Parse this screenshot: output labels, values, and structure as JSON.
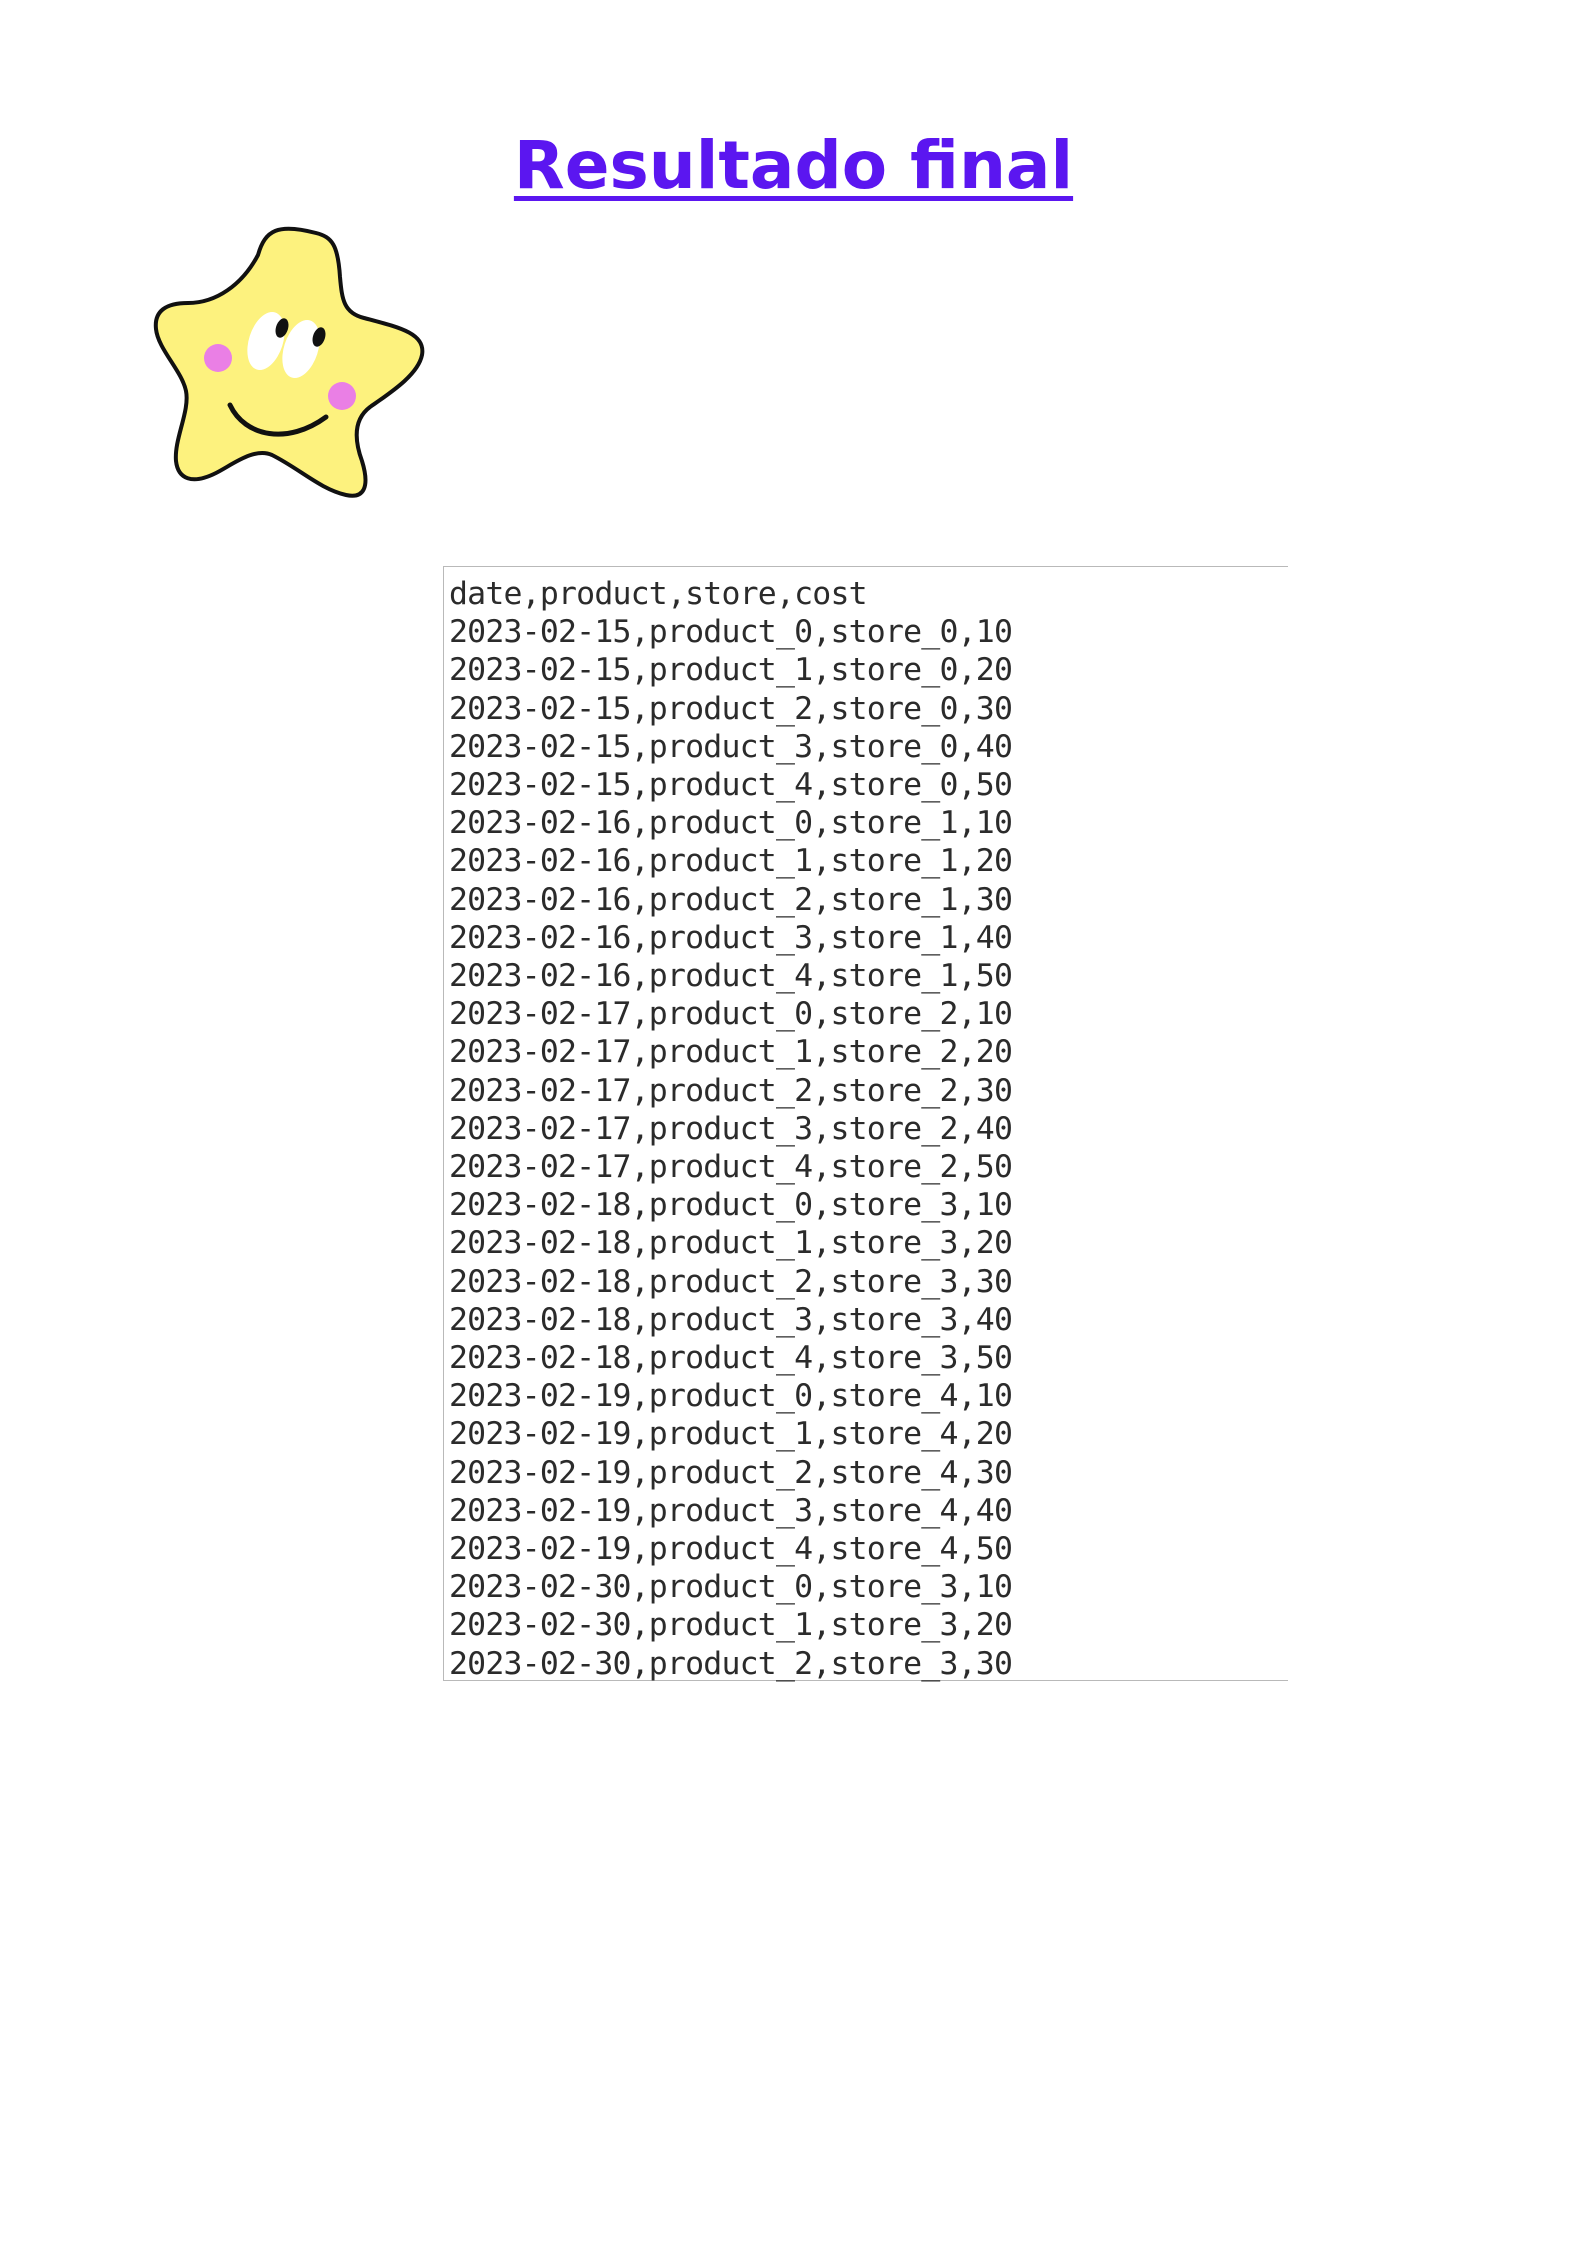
{
  "page": {
    "title": "Resultado final",
    "accent_color": "#5b16f0"
  },
  "illustration": {
    "icon": "smiling-star-icon",
    "colors": {
      "body": "#fdf27e",
      "outline": "#111111",
      "cheeks": "#ea7fe5"
    }
  },
  "csv_file": {
    "lines": [
      "date,product,store,cost",
      "2023-02-15,product_0,store_0,10",
      "2023-02-15,product_1,store_0,20",
      "2023-02-15,product_2,store_0,30",
      "2023-02-15,product_3,store_0,40",
      "2023-02-15,product_4,store_0,50",
      "2023-02-16,product_0,store_1,10",
      "2023-02-16,product_1,store_1,20",
      "2023-02-16,product_2,store_1,30",
      "2023-02-16,product_3,store_1,40",
      "2023-02-16,product_4,store_1,50",
      "2023-02-17,product_0,store_2,10",
      "2023-02-17,product_1,store_2,20",
      "2023-02-17,product_2,store_2,30",
      "2023-02-17,product_3,store_2,40",
      "2023-02-17,product_4,store_2,50",
      "2023-02-18,product_0,store_3,10",
      "2023-02-18,product_1,store_3,20",
      "2023-02-18,product_2,store_3,30",
      "2023-02-18,product_3,store_3,40",
      "2023-02-18,product_4,store_3,50",
      "2023-02-19,product_0,store_4,10",
      "2023-02-19,product_1,store_4,20",
      "2023-02-19,product_2,store_4,30",
      "2023-02-19,product_3,store_4,40",
      "2023-02-19,product_4,store_4,50",
      "2023-02-30,product_0,store_3,10",
      "2023-02-30,product_1,store_3,20",
      "2023-02-30,product_2,store_3,30"
    ]
  }
}
